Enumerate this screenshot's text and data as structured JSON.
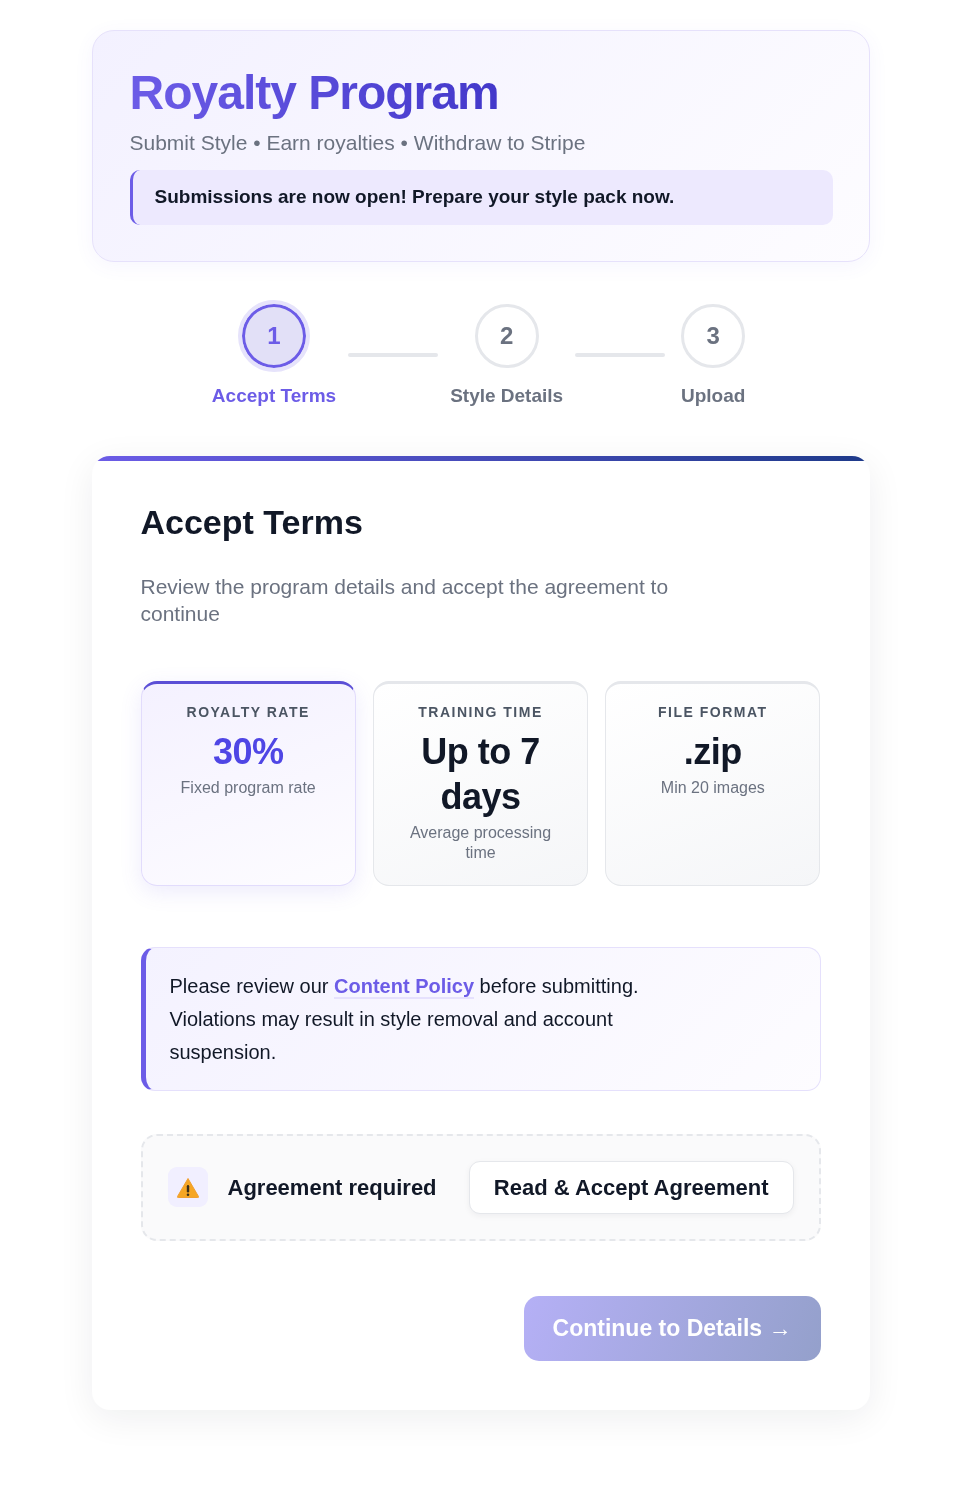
{
  "header": {
    "title": "Royalty Program",
    "subtitle": "Submit Style • Earn royalties • Withdraw to Stripe",
    "notice": "Submissions are now open! Prepare your style pack now."
  },
  "steps": [
    {
      "number": "1",
      "label": "Accept Terms",
      "selected": true
    },
    {
      "number": "2",
      "label": "Style Details",
      "selected": false
    },
    {
      "number": "3",
      "label": "Upload",
      "selected": false
    }
  ],
  "panel": {
    "title": "Accept Terms",
    "description": "Review the program details and accept the agreement to continue",
    "stats": [
      {
        "label": "ROYALTY RATE",
        "value": "30%",
        "caption": "Fixed program rate",
        "highlighted": true
      },
      {
        "label": "TRAINING TIME",
        "value": "Up to 7 days",
        "caption": "Average processing time",
        "highlighted": false
      },
      {
        "label": "FILE FORMAT",
        "value": ".zip",
        "caption": "Min 20 images",
        "highlighted": false
      }
    ],
    "policy_note": {
      "before": "Please review our ",
      "link": "Content Policy",
      "after": " before submitting. Violations may result in style removal and account suspension."
    },
    "agreement": {
      "status": "Agreement required",
      "button": "Read & Accept Agreement"
    },
    "continue_button": {
      "label": "Continue to Details →",
      "disabled": true
    }
  }
}
